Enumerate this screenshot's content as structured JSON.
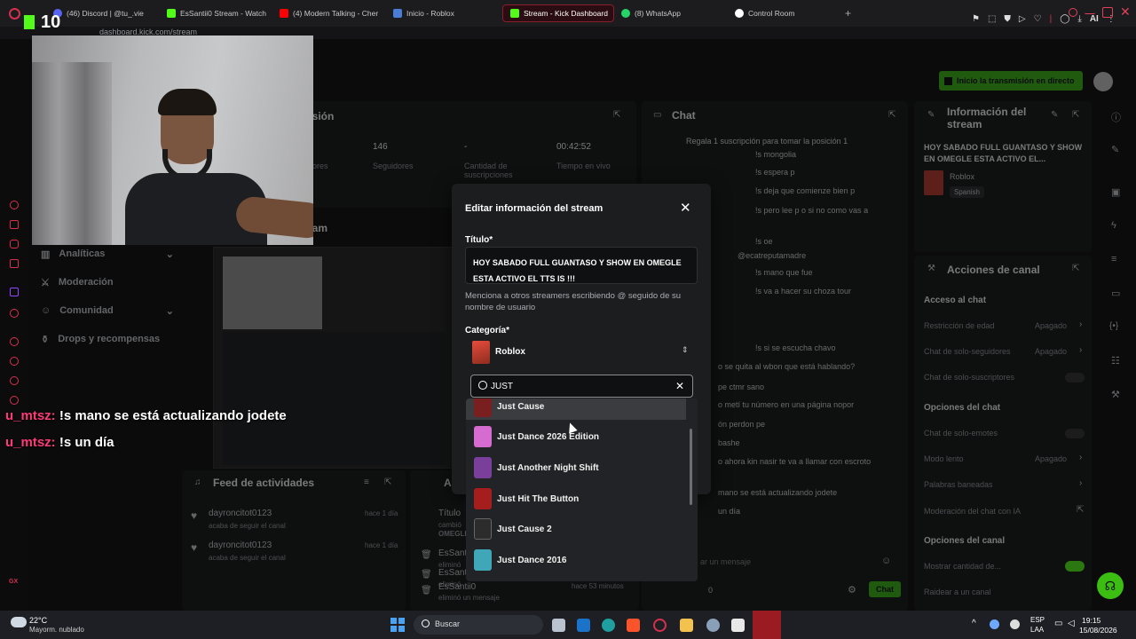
{
  "browser": {
    "tabs": [
      {
        "label": "(46) Discord | @tu_.vie",
        "color": "#5865f2"
      },
      {
        "label": "EsSantii0 Stream - Watch L",
        "color": "#53fc18"
      },
      {
        "label": "(4) Modern Talking - Cher",
        "color": "#ff0000"
      },
      {
        "label": "Inicio - Roblox",
        "color": "#4a7bd5"
      },
      {
        "label": "Stream - Kick Dashboard",
        "color": "#53fc18"
      },
      {
        "label": "(8) WhatsApp",
        "color": "#25d366"
      },
      {
        "label": "Control Room",
        "color": "#ffffff"
      }
    ],
    "url": "dashboard.kick.com/stream",
    "badge": "10",
    "ai_label": "AI"
  },
  "header": {
    "go_live_label": "Inicio la transmisión en directo"
  },
  "session": {
    "title": "esión",
    "stats": [
      {
        "value": "",
        "label": "idores"
      },
      {
        "value": "146",
        "label": "Seguidores"
      },
      {
        "value": "-",
        "label": "Cantidad de suscripciones"
      },
      {
        "value": "00:42:52",
        "label": "Tiempo en vivo"
      }
    ]
  },
  "sidebar": {
    "items": [
      {
        "label": "Analíticas",
        "icon": "chart-icon",
        "chevron": true
      },
      {
        "label": "Moderación",
        "icon": "sword-icon",
        "chevron": false
      },
      {
        "label": "Comunidad",
        "icon": "people-icon",
        "chevron": true
      },
      {
        "label": "Drops y recompensas",
        "icon": "gift-icon",
        "chevron": false
      }
    ]
  },
  "preview": {
    "title": "eam"
  },
  "chat": {
    "title": "Chat",
    "pinned": "Regala 1 suscripción para tomar la posición 1",
    "messages": [
      "!s mongolia",
      "!s espera p",
      "!s deja que comienze bien p",
      "!s pero lee p o si no como vas a",
      "!s oe",
      "@ecatreputamadre",
      "!s mano que fue",
      "!s va a hacer su choza tour",
      "!s si se escucha chavo",
      "o se quita al wbon que está hablando?",
      "pe ctmr sano",
      "o metí tu número en una página nopor",
      "ón perdon pe",
      "bashe",
      "o ahora kin nasir te va a llamar con escroto",
      "mano se está actualizando jodete",
      "un día"
    ],
    "input_placeholder": "ar un mensaje",
    "viewer_count": "0",
    "send_label": "Chat"
  },
  "stream_info": {
    "title": "Información del stream",
    "stream_title": "HOY SABADO FULL GUANTASO Y SHOW EN OMEGLE ESTA ACTIVO EL...",
    "category": "Roblox",
    "language": "Spanish"
  },
  "channel_actions": {
    "title": "Acciones de canal",
    "sections": [
      {
        "heading": "Acceso al chat",
        "rows": [
          {
            "label": "Restricción de edad",
            "value": "Apagado",
            "control": "chevron"
          },
          {
            "label": "Chat de solo-seguidores",
            "value": "Apagado",
            "control": "chevron"
          },
          {
            "label": "Chat de solo-suscriptores",
            "value": "",
            "control": "toggle-off"
          }
        ]
      },
      {
        "heading": "Opciones del chat",
        "rows": [
          {
            "label": "Chat de solo-emotes",
            "value": "",
            "control": "toggle-off"
          },
          {
            "label": "Modo lento",
            "value": "Apagado",
            "control": "chevron"
          },
          {
            "label": "Palabras baneadas",
            "value": "",
            "control": "chevron"
          },
          {
            "label": "Moderación del chat con IA",
            "value": "",
            "control": "external"
          }
        ]
      },
      {
        "heading": "Opciones del canal",
        "rows": [
          {
            "label": "Mostrar cantidad de...",
            "value": "",
            "control": "toggle-on"
          },
          {
            "label": "Raidear a un canal",
            "value": "",
            "control": "none"
          }
        ]
      }
    ]
  },
  "activity_feed": {
    "title": "Feed de actividades",
    "items": [
      {
        "user": "dayroncitot0123",
        "action": "acaba de seguir el canal",
        "time": "hace 1 día"
      },
      {
        "user": "dayroncitot0123",
        "action": "acaba de seguir el canal",
        "time": "hace 1 día"
      }
    ]
  },
  "audit_log": {
    "title": "A",
    "items": [
      {
        "user": "Título",
        "action": "cambió",
        "extra": "OMEGLE"
      },
      {
        "user": "EsSantii0",
        "action": "eliminó"
      },
      {
        "user": "EsSantii0",
        "action": "eliminó"
      },
      {
        "user": "EsSantii0",
        "action": "eliminó un mensaje",
        "time": "hace 53 minutos"
      }
    ]
  },
  "overlay_chat": [
    {
      "user": "u_mtsz:",
      "text": "!s mano se está actualizando jodete"
    },
    {
      "user": "u_mtsz:",
      "text": "!s un día"
    }
  ],
  "modal": {
    "title": "Editar información del stream",
    "title_label": "Título*",
    "title_value": "HOY SABADO FULL GUANTASO Y SHOW EN OMEGLE ESTA ACTIVO EL TTS IS !!!",
    "hint": "Menciona a otros streamers escribiendo @ seguido de su nombre de usuario",
    "category_label": "Categoría*",
    "category_value": "Roblox",
    "search_value": "JUST",
    "results": [
      {
        "label": "Just Cause",
        "color": "#7a1f1f"
      },
      {
        "label": "Just Dance 2026 Edition",
        "color": "#d66bd2"
      },
      {
        "label": "Just Another Night Shift",
        "color": "#7a3f9a"
      },
      {
        "label": "Just Hit The Button",
        "color": "#a51d1d"
      },
      {
        "label": "Just Cause 2",
        "color": "#2c2c2c"
      },
      {
        "label": "Just Dance 2016",
        "color": "#3fa7b8"
      }
    ]
  },
  "taskbar": {
    "weather_temp": "22°C",
    "weather_desc": "Mayorm. nublado",
    "search_placeholder": "Buscar",
    "lang": "ESP",
    "lang_sub": "LAA",
    "time": "19:15",
    "date": "15/08/2026"
  },
  "colors": {
    "kick_green": "#53fc18",
    "accent_red": "#d6304f"
  }
}
